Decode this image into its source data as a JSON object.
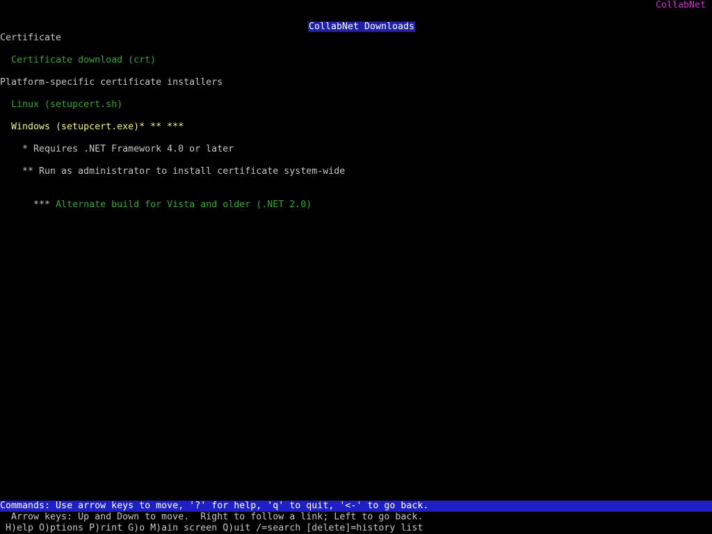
{
  "window": {
    "title": "CollabNet Downloads",
    "brand": "CollabNet"
  },
  "content": {
    "section_certificate": "Certificate",
    "link_cert_download": "Certificate download (crt)",
    "section_installers": "Platform-specific certificate installers",
    "link_linux": "Linux (setupcert.sh)",
    "link_windows": "Windows (setupcert.exe)* ** ***",
    "note_1": "* Requires .NET Framework 4.0 or later",
    "note_2": "** Run as administrator to install certificate system-wide",
    "note_3_prefix": "*** ",
    "link_alt_build": "Alternate build for Vista and older (.NET 2.0)"
  },
  "status": {
    "commands": "Commands: Use arrow keys to move, '?' for help, 'q' to quit, '<-' to go back.",
    "arrow_help": "  Arrow keys: Up and Down to move.  Right to follow a link; Left to go back.",
    "keys_help": " H)elp O)ptions P)rint G)o M)ain screen Q)uit /=search [delete]=history list"
  },
  "colors": {
    "background": "#000000",
    "link": "#2fa82f",
    "link_selected": "#f5f57a",
    "text": "#c6c6c6",
    "brand": "#c62fc6",
    "title_bg": "#1f1fa8",
    "command_bar_bg": "#1f1fc6"
  }
}
